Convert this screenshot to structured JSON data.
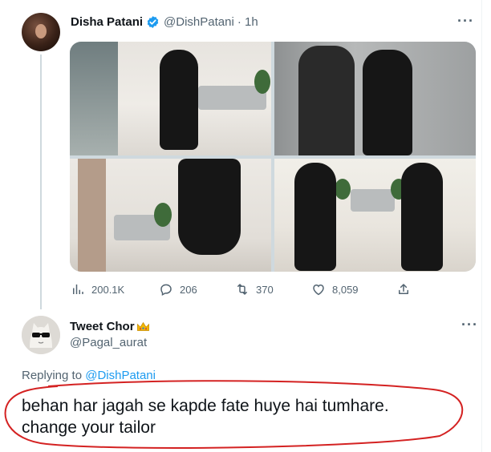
{
  "tweet": {
    "author_name": "Disha Patani",
    "author_handle": "@DishPatani",
    "time": "· 1h",
    "more_label": "···",
    "stats": {
      "views": "200.1K",
      "replies": "206",
      "retweets": "370",
      "likes": "8,059"
    },
    "verified_color": "#1d9bf0"
  },
  "reply": {
    "author_name": "Tweet Chor",
    "author_handle": "@Pagal_aurat",
    "more_label": "···",
    "replying_prefix": "Replying to",
    "replying_to": "@DishPatani",
    "text_line1": "behan har jagah se kapde fate huye hai tumhare.",
    "text_line2": "change your tailor"
  },
  "colors": {
    "link": "#1d9bf0",
    "secondary_text": "#536471",
    "annotation": "#d42222"
  }
}
